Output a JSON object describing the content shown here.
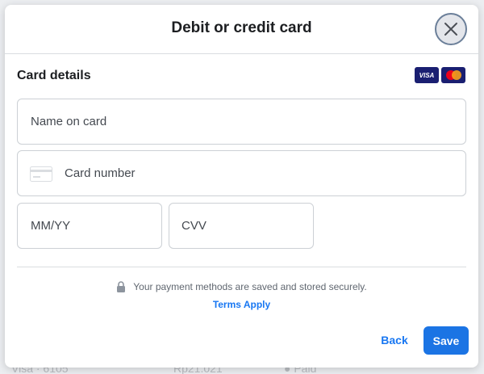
{
  "modal": {
    "title": "Debit or credit card",
    "close_icon": "close-icon"
  },
  "card_details": {
    "title": "Card details",
    "logos": [
      "visa-logo",
      "mastercard-logo"
    ],
    "visa_text": "VISA"
  },
  "form": {
    "name_placeholder": "Name on card",
    "card_number_placeholder": "Card number",
    "card_icon": "card-icon",
    "expiry_placeholder": "MM/YY",
    "cvv_placeholder": "CVV"
  },
  "footer": {
    "secure_text": "Your payment methods are saved and stored securely.",
    "lock_icon": "lock-icon",
    "terms_label": "Terms Apply",
    "back_label": "Back",
    "save_label": "Save"
  },
  "colors": {
    "accent": "#1b74e4",
    "link": "#1877f2",
    "title_text": "#1c1e21",
    "border": "#ccd0d5"
  }
}
